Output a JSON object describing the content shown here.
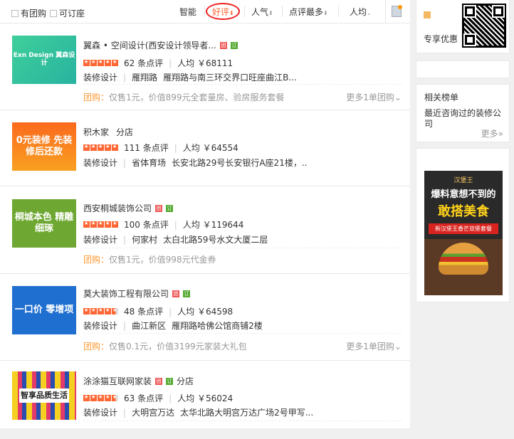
{
  "filters": {
    "group_buy": "有团购",
    "bookable": "可订座"
  },
  "sort": [
    {
      "label": "智能",
      "arrow": ""
    },
    {
      "label": "好评",
      "arrow": "⬇"
    },
    {
      "label": "人气",
      "arrow": "⬇"
    },
    {
      "label": "点评最多",
      "arrow": "⬇"
    },
    {
      "label": "人均",
      "arrow": "⌄"
    }
  ],
  "shops": [
    {
      "title": "翼森 • 空间设计(西安设计领导者...",
      "thumb": "Exn Design 翼森设计",
      "tuan": "团",
      "ding": "订",
      "reviews": "62 条点评",
      "avg": "人均 ￥68111",
      "category": "装修设计",
      "area": "雁翔路",
      "address": "雁翔路与南三环交界口旺座曲江B...",
      "deal_label": "团购：",
      "deal": "仅售1元，价值899元全套量房、验房服务套餐",
      "more": "更多1单团购⌄",
      "rating": 5
    },
    {
      "title": "积木家",
      "branch": "分店",
      "thumb": "0元装修 先装修后还款",
      "reviews": "111 条点评",
      "avg": "人均 ￥64554",
      "category": "装修设计",
      "area": "省体育场",
      "address": "长安北路29号长安银行A座21楼，..",
      "rating": 5
    },
    {
      "title": "西安桐城装饰公司",
      "thumb": "桐城本色 精雕细琢",
      "tuan": "团",
      "ding": "订",
      "reviews": "100 条点评",
      "avg": "人均 ￥119644",
      "category": "装修设计",
      "area": "何家村",
      "address": "太白北路59号水文大厦二层",
      "deal_label": "团购：",
      "deal": "仅售1元，价值998元代金券",
      "rating": 5
    },
    {
      "title": "莫大装饰工程有限公司",
      "thumb": "一口价 零增项",
      "tuan": "团",
      "ding": "订",
      "reviews": "48 条点评",
      "avg": "人均 ￥64598",
      "category": "装修设计",
      "area": "曲江新区",
      "address": "雁翔路哈佛公馆商铺2楼",
      "deal_label": "团购：",
      "deal": "仅售0.1元，价值3199元家装大礼包",
      "more": "更多1单团购⌄",
      "rating": 4.5
    },
    {
      "title": "涂涂猫互联网家装",
      "branch": "分店",
      "thumb": "智享品质生活",
      "tuan": "团",
      "ding": "订",
      "reviews": "63 条点评",
      "avg": "人均 ￥56024",
      "category": "装修设计",
      "area": "大明宫万达",
      "address": "太华北路大明宫万达广场2号甲写...",
      "rating": 4.5
    }
  ],
  "sidebar": {
    "exclusive": "专享优惠",
    "related_title": "相关榜单",
    "related_item": "最近咨询过的装修公司",
    "more": "更多»",
    "ad": {
      "brand": "汉堡王",
      "line1": "爆料意想不到的",
      "line2": "敢搭美食",
      "line3": "新汉堡王香芒双堡套餐"
    }
  }
}
